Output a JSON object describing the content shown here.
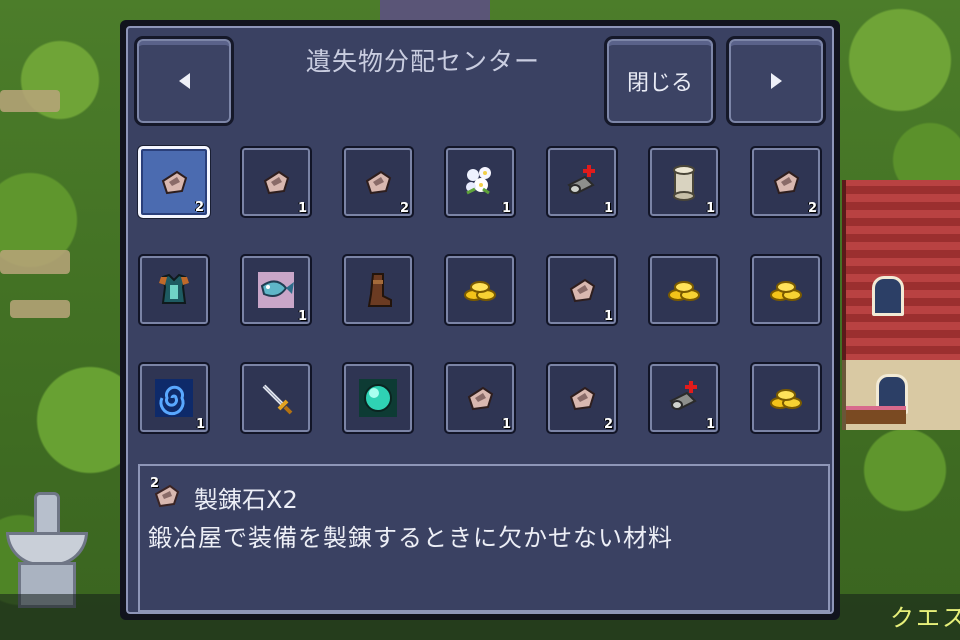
{
  "window": {
    "title": "遺失物分配センター"
  },
  "buttons": {
    "prev": "previous",
    "close": "閉じる",
    "next": "next"
  },
  "slots": [
    {
      "icon": "refining-stone-icon",
      "qty": "2",
      "selected": true
    },
    {
      "icon": "refining-stone-icon",
      "qty": "1"
    },
    {
      "icon": "refining-stone-icon",
      "qty": "2"
    },
    {
      "icon": "flower-bouquet-icon",
      "qty": "1"
    },
    {
      "icon": "repair-kit-icon",
      "qty": "1"
    },
    {
      "icon": "scroll-icon",
      "qty": "1"
    },
    {
      "icon": "refining-stone-icon",
      "qty": "2"
    },
    {
      "icon": "armor-icon",
      "qty": ""
    },
    {
      "icon": "fish-icon",
      "qty": "1"
    },
    {
      "icon": "boots-icon",
      "qty": ""
    },
    {
      "icon": "gold-coins-icon",
      "qty": ""
    },
    {
      "icon": "refining-stone-icon",
      "qty": "1"
    },
    {
      "icon": "gold-coins-icon",
      "qty": ""
    },
    {
      "icon": "gold-coins-icon",
      "qty": ""
    },
    {
      "icon": "vortex-icon",
      "qty": "1"
    },
    {
      "icon": "sword-icon",
      "qty": ""
    },
    {
      "icon": "orb-icon",
      "qty": ""
    },
    {
      "icon": "refining-stone-icon",
      "qty": "1"
    },
    {
      "icon": "refining-stone-icon",
      "qty": "2"
    },
    {
      "icon": "repair-kit-icon",
      "qty": "1"
    },
    {
      "icon": "gold-coins-icon",
      "qty": ""
    }
  ],
  "detail": {
    "qty": "2",
    "name": "製錬石X2",
    "description": "鍛冶屋で装備を製錬するときに欠かせない材料"
  },
  "hud": {
    "quest_label": "クエス"
  },
  "colors": {
    "panel": "#3a4162",
    "selected_slot": "#4b6bb0",
    "quest_text": "#e7f07a"
  }
}
